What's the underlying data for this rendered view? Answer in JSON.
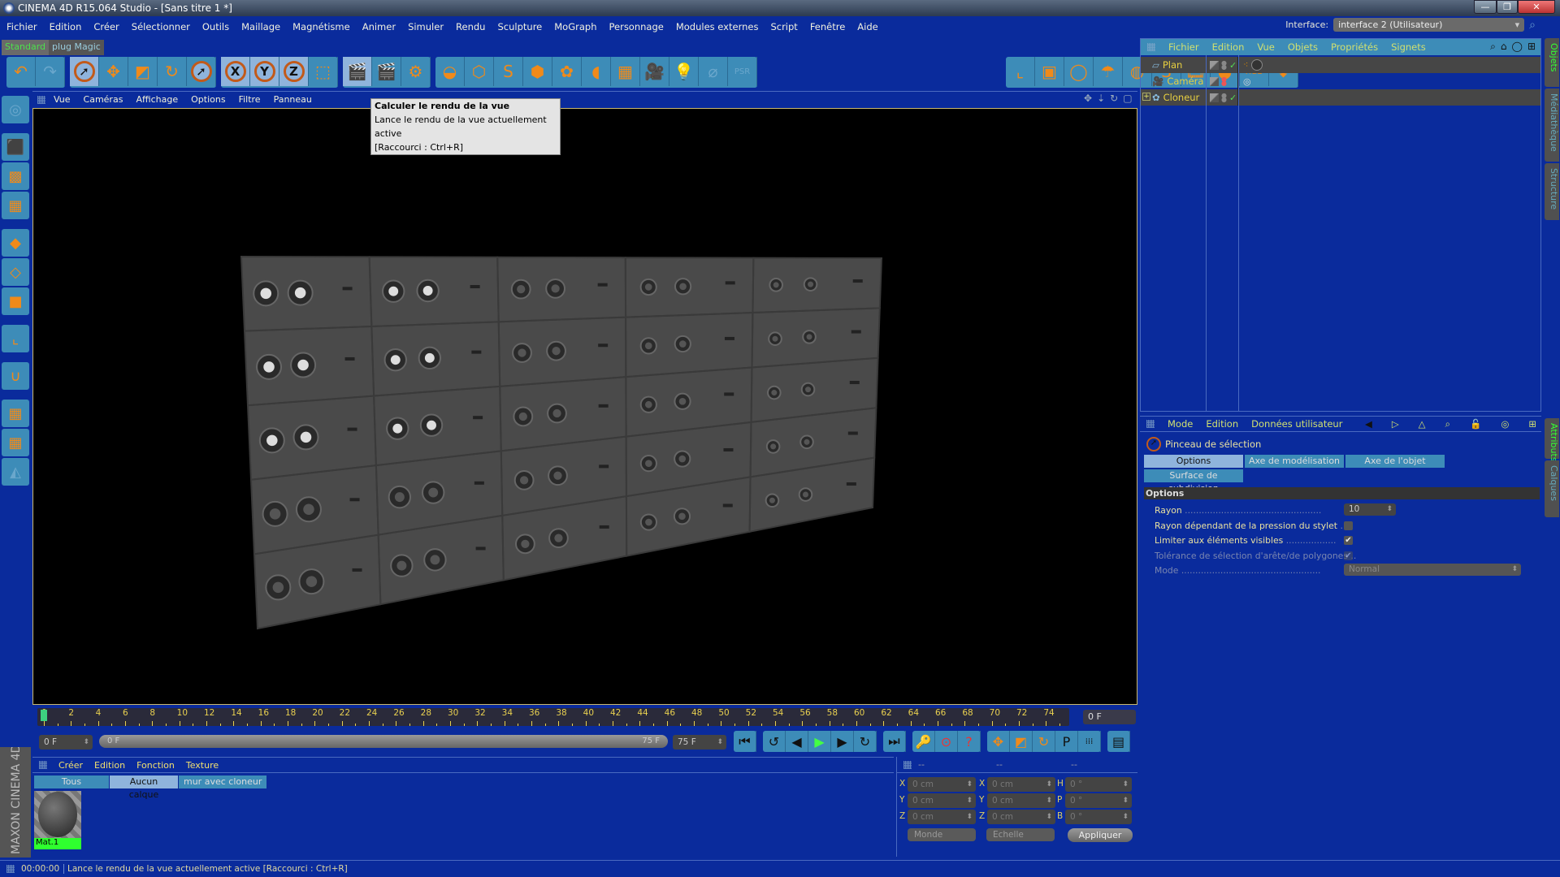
{
  "window": {
    "title": "CINEMA 4D R15.064 Studio - [Sans titre 1 *]",
    "min": "—",
    "max": "❐",
    "close": "✕"
  },
  "menu": [
    "Fichier",
    "Edition",
    "Créer",
    "Sélectionner",
    "Outils",
    "Maillage",
    "Magnétisme",
    "Animer",
    "Simuler",
    "Rendu",
    "Sculpture",
    "MoGraph",
    "Personnage",
    "Modules externes",
    "Script",
    "Fenêtre",
    "Aide"
  ],
  "interface": {
    "label": "Interface:",
    "value": "interface 2 (Utilisateur)"
  },
  "layout_tabs": [
    {
      "label": "Standard",
      "active": true
    },
    {
      "label": "plug Magic",
      "active": false
    }
  ],
  "toolbar_groups": [
    [
      {
        "icon": "undo-icon",
        "g": "↶"
      },
      {
        "icon": "redo-icon",
        "g": "↷",
        "dim": true
      }
    ],
    [
      {
        "icon": "live-selection-icon",
        "g": "➚",
        "circ": true,
        "sel": true
      },
      {
        "icon": "move-icon",
        "g": "✥"
      },
      {
        "icon": "scale-icon",
        "g": "◩"
      },
      {
        "icon": "rotate-icon",
        "g": "↻"
      },
      {
        "icon": "selection-icon",
        "g": "➚",
        "circ": true
      }
    ],
    [
      {
        "icon": "x-axis-icon",
        "g": "X",
        "circ": true,
        "sel": true
      },
      {
        "icon": "y-axis-icon",
        "g": "Y",
        "circ": true,
        "sel": true
      },
      {
        "icon": "z-axis-icon",
        "g": "Z",
        "circ": true,
        "sel": true
      },
      {
        "icon": "coordinate-system-icon",
        "g": "⬚"
      }
    ],
    [
      {
        "icon": "render-view-icon",
        "g": "🎬",
        "sel": true
      },
      {
        "icon": "render-picture-viewer-icon",
        "g": "🎬"
      },
      {
        "icon": "render-settings-icon",
        "g": "⚙"
      }
    ],
    [
      {
        "icon": "sculpt-object-icon",
        "g": "◒"
      },
      {
        "icon": "cube-icon",
        "g": "⬡"
      },
      {
        "icon": "spline-pen-icon",
        "g": "S"
      },
      {
        "icon": "subdivision-icon",
        "g": "⬢"
      },
      {
        "icon": "cloner-icon",
        "g": "✿"
      },
      {
        "icon": "deformer-icon",
        "g": "◖"
      },
      {
        "icon": "floor-icon",
        "g": "▦"
      },
      {
        "icon": "camera-icon",
        "g": "🎥"
      },
      {
        "icon": "light-icon",
        "g": "💡"
      },
      {
        "icon": "paint-icon",
        "g": "⌀",
        "dim": true
      },
      {
        "icon": "psr-icon",
        "g": "PSR",
        "dim": true
      }
    ],
    [
      {
        "icon": "axis-snap-icon",
        "g": "⌞"
      },
      {
        "icon": "grid-cube-icon",
        "g": "▣"
      },
      {
        "icon": "mirror-icon",
        "g": "◯"
      },
      {
        "icon": "drop-icon",
        "g": "☂"
      },
      {
        "icon": "checker-icon",
        "g": "◍"
      },
      {
        "icon": "s-plugin-icon",
        "g": "S"
      },
      {
        "icon": "clapper-icon",
        "g": "🎞"
      },
      {
        "icon": "paint-sphere-icon",
        "g": "●"
      },
      {
        "icon": "rgb-icon",
        "g": "RGB"
      },
      {
        "icon": "drop-to-floor-icon",
        "g": "⬇"
      }
    ]
  ],
  "left_tools": [
    {
      "icon": "workplane-icon",
      "g": "◎",
      "dim": true
    },
    {
      "gap": true
    },
    {
      "icon": "model-mode-icon",
      "g": "⬛",
      "sel": true
    },
    {
      "icon": "texture-mode-icon",
      "g": "▩"
    },
    {
      "icon": "workplane-grid-icon",
      "g": "▦"
    },
    {
      "gap": true
    },
    {
      "icon": "points-mode-icon",
      "g": "◆"
    },
    {
      "icon": "edges-mode-icon",
      "g": "◇"
    },
    {
      "icon": "polygons-mode-icon",
      "g": "■"
    },
    {
      "gap": true
    },
    {
      "icon": "axis-mode-icon",
      "g": "⌞"
    },
    {
      "gap": true
    },
    {
      "icon": "snap-magnet-icon",
      "g": "∪"
    },
    {
      "gap": true
    },
    {
      "icon": "lock-workplane-icon",
      "g": "▦",
      "sel": true
    },
    {
      "icon": "workplane-align-icon",
      "g": "▦"
    },
    {
      "icon": "sculpt-icon",
      "g": "◭",
      "dim": true
    }
  ],
  "viewport": {
    "menu": [
      "Vue",
      "Caméras",
      "Affichage",
      "Options",
      "Filtre",
      "Panneau"
    ],
    "nav_icons": [
      "move-view-icon",
      "zoom-view-icon",
      "rotate-view-icon",
      "toggle-view-icon"
    ]
  },
  "tooltip": {
    "title": "Calculer le rendu de la vue",
    "desc": "Lance le rendu de la vue actuellement active",
    "shortcut": "[Raccourci : Ctrl+R]"
  },
  "timeline": {
    "start": 0,
    "end": 74,
    "step": 2,
    "current": "0 F",
    "frame_field": "0 F",
    "range_start": "0 F",
    "range_bar_start": "0 F",
    "range_bar_end": "75 F",
    "range_end": "75 F"
  },
  "playback": [
    [
      {
        "icon": "go-to-start-icon",
        "g": "⏮"
      }
    ],
    [
      {
        "icon": "prev-key-icon",
        "g": "↺"
      },
      {
        "icon": "prev-frame-icon",
        "g": "◀"
      },
      {
        "icon": "play-icon",
        "g": "▶"
      },
      {
        "icon": "next-frame-icon",
        "g": "▶"
      },
      {
        "icon": "next-key-icon",
        "g": "↻"
      }
    ],
    [
      {
        "icon": "go-to-end-icon",
        "g": "⏭"
      }
    ],
    [
      {
        "icon": "record-key-icon",
        "g": "🔑"
      },
      {
        "icon": "autokey-icon",
        "g": "⊙"
      },
      {
        "icon": "keyframe-selection-icon",
        "g": "?"
      }
    ],
    [
      {
        "icon": "key-position-icon",
        "g": "✥"
      },
      {
        "icon": "key-scale-icon",
        "g": "◩"
      },
      {
        "icon": "key-rotation-icon",
        "g": "↻"
      },
      {
        "icon": "key-parameter-icon",
        "g": "P"
      },
      {
        "icon": "key-pla-icon",
        "g": "⁞⁞⁞"
      }
    ],
    [
      {
        "icon": "timeline-window-icon",
        "g": "▤"
      }
    ]
  ],
  "materials": {
    "menu": [
      "Créer",
      "Edition",
      "Fonction",
      "Texture"
    ],
    "tabs": [
      {
        "label": "Tous"
      },
      {
        "label": "Aucun calque",
        "active": true
      },
      {
        "label": "mur avec cloneur"
      }
    ],
    "items": [
      {
        "name": "Mat.1"
      }
    ]
  },
  "coords": {
    "headers": [
      "--",
      "--",
      "--"
    ],
    "rows": [
      {
        "l1": "X",
        "v1": "0 cm",
        "l2": "X",
        "v2": "0 cm",
        "l3": "H",
        "v3": "0 °"
      },
      {
        "l1": "Y",
        "v1": "0 cm",
        "l2": "Y",
        "v2": "0 cm",
        "l3": "P",
        "v3": "0 °"
      },
      {
        "l1": "Z",
        "v1": "0 cm",
        "l2": "Z",
        "v2": "0 cm",
        "l3": "B",
        "v3": "0 °"
      }
    ],
    "mode": "Monde",
    "scale": "Echelle",
    "apply": "Appliquer"
  },
  "status": {
    "time": "00:00:00",
    "text": "Lance le rendu de la vue actuellement active [Raccourci : Ctrl+R]"
  },
  "brand": "MAXON CINEMA 4D",
  "objects": {
    "menu": [
      "Fichier",
      "Edition",
      "Vue",
      "Objets",
      "Propriétés",
      "Signets"
    ],
    "items": [
      {
        "name": "Plan",
        "icon": "plane-icon",
        "check": true
      },
      {
        "name": "Caméra",
        "icon": "camera-icon",
        "check": false
      },
      {
        "name": "Cloneur",
        "icon": "cloner-icon",
        "check": true,
        "expandable": true
      }
    ]
  },
  "attributes": {
    "menu": [
      "Mode",
      "Edition",
      "Données utilisateur"
    ],
    "tool": "Pinceau de sélection",
    "tabs": [
      "Options",
      "Axe de modélisation",
      "Axe de l'objet",
      "Surface de subdivision"
    ],
    "section": "Options",
    "props": [
      {
        "label": "Rayon",
        "value": "10"
      },
      {
        "label": "Rayon dépendant de la pression du stylet",
        "checked": false
      },
      {
        "label": "Limiter aux éléments visibles",
        "checked": true
      },
      {
        "label": "Tolérance de sélection d'arête/de polygones",
        "checked": true,
        "disabled": true
      },
      {
        "label": "Mode",
        "value": "Normal",
        "disabled": true
      }
    ]
  },
  "side_tabs": [
    {
      "label": "Objets",
      "active": true
    },
    {
      "label": "Médiathèque"
    },
    {
      "label": "Structure"
    },
    {
      "label": "Attributs",
      "active": true
    },
    {
      "label": "Calques"
    }
  ],
  "colors": {
    "background": "#0a2b9c",
    "button": "#3d8cb8",
    "button_selected": "#8fb4dc",
    "accent_orange": "#f08a1a",
    "object_name": "#e8d040",
    "material_label": "#2fff2f"
  }
}
